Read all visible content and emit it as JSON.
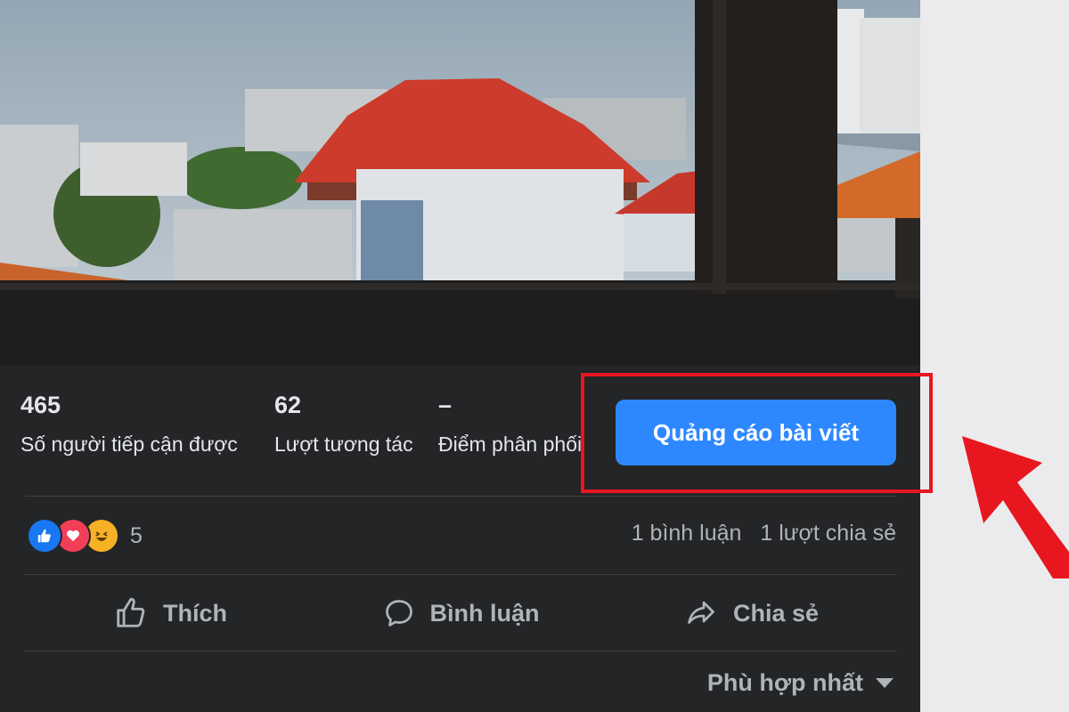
{
  "stats": [
    {
      "value": "465",
      "label": "Số người tiếp cận được"
    },
    {
      "value": "62",
      "label": "Lượt tương tác"
    },
    {
      "value": "–",
      "label": "Điểm phân phối"
    }
  ],
  "promote_button": "Quảng cáo bài viết",
  "reactions": {
    "icons": [
      "like-icon",
      "love-icon",
      "haha-icon"
    ],
    "count": "5",
    "comments": "1 bình luận",
    "shares": "1 lượt chia sẻ"
  },
  "actions": {
    "like": "Thích",
    "comment": "Bình luận",
    "share": "Chia sẻ"
  },
  "sort": "Phù hợp nhất",
  "colors": {
    "accent": "#2d88ff",
    "highlight": "#e8161f",
    "background": "#242526"
  }
}
